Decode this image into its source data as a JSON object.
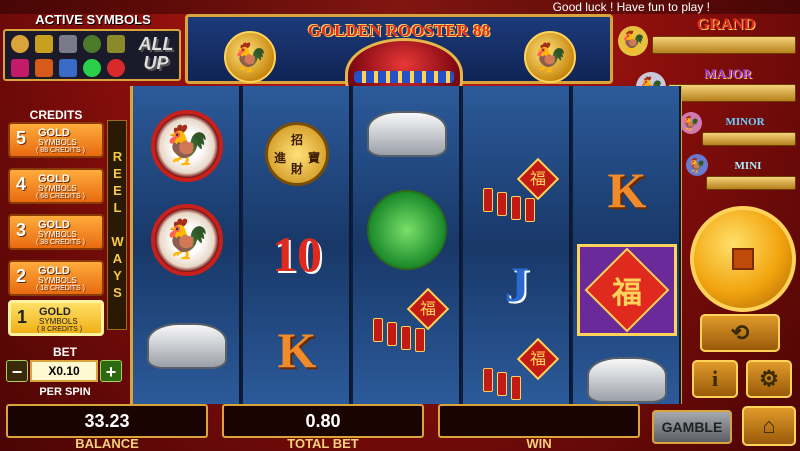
{
  "ticker": "Good luck ! Have fun to play !",
  "active_symbols": {
    "title": "ACTIVE SYMBOLS",
    "all_up": "ALL UP"
  },
  "game_title": "GOLDEN ROOSTER 88",
  "jackpots": [
    {
      "label": "GRAND",
      "color": "#e02a1e"
    },
    {
      "label": "MAJOR",
      "color": "#7a2ad0"
    },
    {
      "label": "MINOR",
      "color": "#2a8ad0"
    },
    {
      "label": "MINI",
      "color": "#2a6ad0"
    }
  ],
  "credits": {
    "title": "CREDITS",
    "options": [
      {
        "number": "5",
        "gold": "GOLD",
        "symbols": "SYMBOLS",
        "credits": "( 88 CREDITS )",
        "selected": false
      },
      {
        "number": "4",
        "gold": "GOLD",
        "symbols": "SYMBOLS",
        "credits": "( 68 CREDITS )",
        "selected": false
      },
      {
        "number": "3",
        "gold": "GOLD",
        "symbols": "SYMBOLS",
        "credits": "( 38 CREDITS )",
        "selected": false
      },
      {
        "number": "2",
        "gold": "GOLD",
        "symbols": "SYMBOLS",
        "credits": "( 18 CREDITS )",
        "selected": false
      },
      {
        "number": "1",
        "gold": "GOLD",
        "symbols": "SYMBOLS",
        "credits": "( 8 CREDITS )",
        "selected": true
      }
    ]
  },
  "reel_ways": "REEL WAYS",
  "bet": {
    "title": "BET",
    "value": "X0.10",
    "minus": "−",
    "plus": "+",
    "per_spin": "PER SPIN"
  },
  "reels": {
    "card_10": "10",
    "card_k": "K",
    "card_j": "J",
    "coin_top": "招",
    "coin_left": "進",
    "coin_right": "寶",
    "coin_bottom": "財",
    "fu": "福"
  },
  "balance": {
    "value": "33.23",
    "label": "BALANCE"
  },
  "total_bet": {
    "value": "0.80",
    "label": "TOTAL BET"
  },
  "win": {
    "value": "",
    "label": "WIN"
  },
  "buttons": {
    "gamble": "GAMBLE",
    "info": "i"
  }
}
